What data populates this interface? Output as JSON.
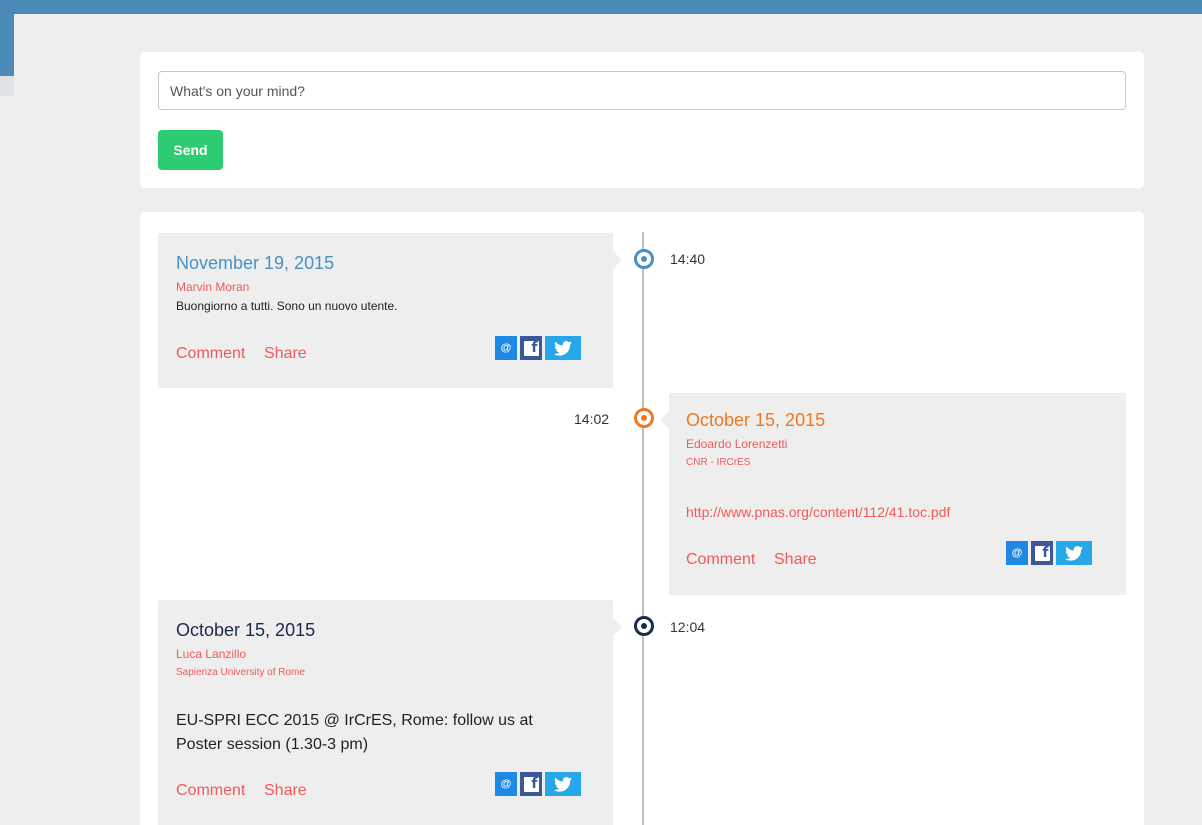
{
  "composer": {
    "placeholder": "What's on your mind?",
    "value": "",
    "send_label": "Send"
  },
  "colors": {
    "header_bar": "#4a89b8",
    "send_button": "#2ecc71",
    "accent_red": "#f05a5a",
    "dot_blue": "#4a90c2",
    "dot_orange": "#f07820",
    "dot_navy": "#1a2a4a"
  },
  "timeline": {
    "posts": [
      {
        "time": "14:40",
        "date": "November 19, 2015",
        "author": "Marvin Moran",
        "affiliation": "",
        "text": "Buongiorno a tutti. Sono un nuovo utente.",
        "link": "",
        "comment_label": "Comment",
        "share_label": "Share",
        "share_icons": [
          "email-icon",
          "facebook-icon",
          "twitter-icon"
        ]
      },
      {
        "time": "14:02",
        "date": "October 15, 2015",
        "author": "Edoardo Lorenzetti",
        "affiliation": "CNR - IRCrES",
        "text": "",
        "link": "http://www.pnas.org/content/112/41.toc.pdf",
        "comment_label": "Comment",
        "share_label": "Share",
        "share_icons": [
          "email-icon",
          "facebook-icon",
          "twitter-icon"
        ]
      },
      {
        "time": "12:04",
        "date": "October 15, 2015",
        "author": "Luca Lanzillo",
        "affiliation": "Sapienza University of Rome",
        "text": "EU-SPRI ECC 2015 @ IrCrES, Rome: follow us at Poster session (1.30-3 pm)",
        "link": "",
        "comment_label": "Comment",
        "share_label": "Share",
        "share_icons": [
          "email-icon",
          "facebook-icon",
          "twitter-icon"
        ]
      }
    ]
  },
  "icons": {
    "email_glyph": "@",
    "facebook_glyph": "f"
  }
}
